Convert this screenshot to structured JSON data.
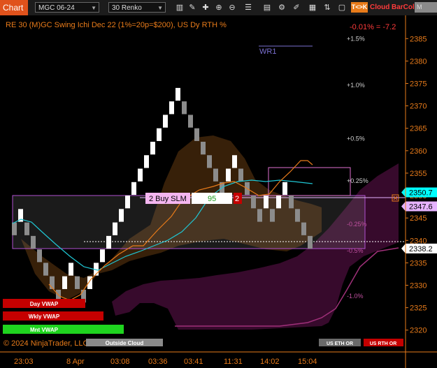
{
  "toolbar": {
    "title": "Chart",
    "symbol": "MGC 06-24",
    "period": "30 Renko",
    "tk_button": "T<>K",
    "cloud_label": "Cloud",
    "barcol_label": "BarCol",
    "mvwap_label": "M VWA"
  },
  "chart": {
    "header": "RE 30 (M)GC Swing Ichi Dec 22 (1%=20p=$200), US Dy RTH %",
    "change_label": "-0.01% = -7.2",
    "wr_label": "WR1",
    "copyright": "© 2024 NinjaTrader, LLC",
    "outside_cloud": "Outside Cloud",
    "order_qty_label": "2 Buy SLM",
    "order_price_value": "95",
    "order_count": "2",
    "us_eth_or": "US ETH OR",
    "us_rth_or": "US RTH OR",
    "vwap_labels": [
      "Day VWAP",
      "Wkly VWAP",
      "Mnt VWAP"
    ],
    "price_flags": [
      {
        "value": "2350.7",
        "color": "#00ffff"
      },
      {
        "value": "2347.6",
        "color": "#e6b3ff"
      },
      {
        "value": "2338.2",
        "color": "#ffffff"
      }
    ],
    "accent_orange": "#e87b1a"
  },
  "chart_data": {
    "type": "line",
    "title": "RE 30 (M)GC Swing Ichi Dec 22 (1%=20p=$200), US Dy RTH %",
    "xlabel": "",
    "ylabel": "",
    "y_ticks": [
      2320,
      2325,
      2330,
      2335,
      2340,
      2345,
      2350,
      2355,
      2360,
      2365,
      2370,
      2375,
      2380,
      2385
    ],
    "ylim": [
      2317,
      2388
    ],
    "x_tick_labels": [
      "23:03",
      "8 Apr",
      "03:08",
      "03:36",
      "03:41",
      "11:31",
      "14:02",
      "15:04"
    ],
    "pct_labels": [
      {
        "label": "+1.5%",
        "y": 2385
      },
      {
        "label": "+1.0%",
        "y": 2374.6
      },
      {
        "label": "+0.5%",
        "y": 2362.7
      },
      {
        "label": "+0.25%",
        "y": 2353.3
      },
      {
        "label": "-0.25%",
        "y": 2343.6
      },
      {
        "label": "-0.5%",
        "y": 2337.7
      },
      {
        "label": "-1.0%",
        "y": 2327.6
      }
    ],
    "renko_bricks": [
      {
        "x": 0,
        "low": 2341,
        "high": 2344,
        "color": "gray"
      },
      {
        "x": 1,
        "low": 2344,
        "high": 2347,
        "color": "white"
      },
      {
        "x": 2,
        "low": 2341,
        "high": 2344,
        "color": "gray"
      },
      {
        "x": 3,
        "low": 2338,
        "high": 2341,
        "color": "gray"
      },
      {
        "x": 4,
        "low": 2335,
        "high": 2338,
        "color": "gray"
      },
      {
        "x": 5,
        "low": 2332,
        "high": 2335,
        "color": "gray"
      },
      {
        "x": 6,
        "low": 2329,
        "high": 2332,
        "color": "gray"
      },
      {
        "x": 7,
        "low": 2326,
        "high": 2329,
        "color": "gray"
      },
      {
        "x": 8,
        "low": 2329,
        "high": 2332,
        "color": "white"
      },
      {
        "x": 9,
        "low": 2332,
        "high": 2335,
        "color": "white"
      },
      {
        "x": 10,
        "low": 2329,
        "high": 2332,
        "color": "gray"
      },
      {
        "x": 11,
        "low": 2326,
        "high": 2329,
        "color": "gray"
      },
      {
        "x": 12,
        "low": 2329,
        "high": 2332,
        "color": "white"
      },
      {
        "x": 13,
        "low": 2332,
        "high": 2335,
        "color": "white"
      },
      {
        "x": 14,
        "low": 2335,
        "high": 2338,
        "color": "white"
      },
      {
        "x": 15,
        "low": 2338,
        "high": 2341,
        "color": "white"
      },
      {
        "x": 16,
        "low": 2341,
        "high": 2344,
        "color": "white"
      },
      {
        "x": 17,
        "low": 2344,
        "high": 2347,
        "color": "white"
      },
      {
        "x": 18,
        "low": 2347,
        "high": 2350,
        "color": "white"
      },
      {
        "x": 19,
        "low": 2350,
        "high": 2353,
        "color": "white"
      },
      {
        "x": 20,
        "low": 2353,
        "high": 2356,
        "color": "white"
      },
      {
        "x": 21,
        "low": 2356,
        "high": 2359,
        "color": "white"
      },
      {
        "x": 22,
        "low": 2359,
        "high": 2362,
        "color": "white"
      },
      {
        "x": 23,
        "low": 2362,
        "high": 2365,
        "color": "white"
      },
      {
        "x": 24,
        "low": 2365,
        "high": 2368,
        "color": "white"
      },
      {
        "x": 25,
        "low": 2368,
        "high": 2371,
        "color": "white"
      },
      {
        "x": 26,
        "low": 2371,
        "high": 2374,
        "color": "white"
      },
      {
        "x": 27,
        "low": 2368,
        "high": 2371,
        "color": "gray"
      },
      {
        "x": 28,
        "low": 2365,
        "high": 2368,
        "color": "gray"
      },
      {
        "x": 29,
        "low": 2362,
        "high": 2365,
        "color": "gray"
      },
      {
        "x": 30,
        "low": 2359,
        "high": 2362,
        "color": "gray"
      },
      {
        "x": 31,
        "low": 2356,
        "high": 2359,
        "color": "gray"
      },
      {
        "x": 32,
        "low": 2353,
        "high": 2356,
        "color": "gray"
      },
      {
        "x": 33,
        "low": 2350,
        "high": 2353,
        "color": "gray"
      },
      {
        "x": 34,
        "low": 2353,
        "high": 2356,
        "color": "white"
      },
      {
        "x": 35,
        "low": 2356,
        "high": 2359,
        "color": "white"
      },
      {
        "x": 36,
        "low": 2353,
        "high": 2356,
        "color": "gray"
      },
      {
        "x": 37,
        "low": 2350,
        "high": 2353,
        "color": "gray"
      },
      {
        "x": 38,
        "low": 2347,
        "high": 2350,
        "color": "gray"
      },
      {
        "x": 39,
        "low": 2344,
        "high": 2347,
        "color": "gray"
      },
      {
        "x": 40,
        "low": 2347,
        "high": 2350,
        "color": "white"
      },
      {
        "x": 41,
        "low": 2344,
        "high": 2347,
        "color": "gray"
      },
      {
        "x": 42,
        "low": 2347,
        "high": 2350,
        "color": "white"
      },
      {
        "x": 43,
        "low": 2350,
        "high": 2353,
        "color": "white"
      },
      {
        "x": 44,
        "low": 2347,
        "high": 2350,
        "color": "gray"
      },
      {
        "x": 45,
        "low": 2344,
        "high": 2347,
        "color": "gray"
      },
      {
        "x": 46,
        "low": 2341,
        "high": 2344,
        "color": "gray"
      },
      {
        "x": 47,
        "low": 2338,
        "high": 2341,
        "color": "gray"
      }
    ]
  }
}
